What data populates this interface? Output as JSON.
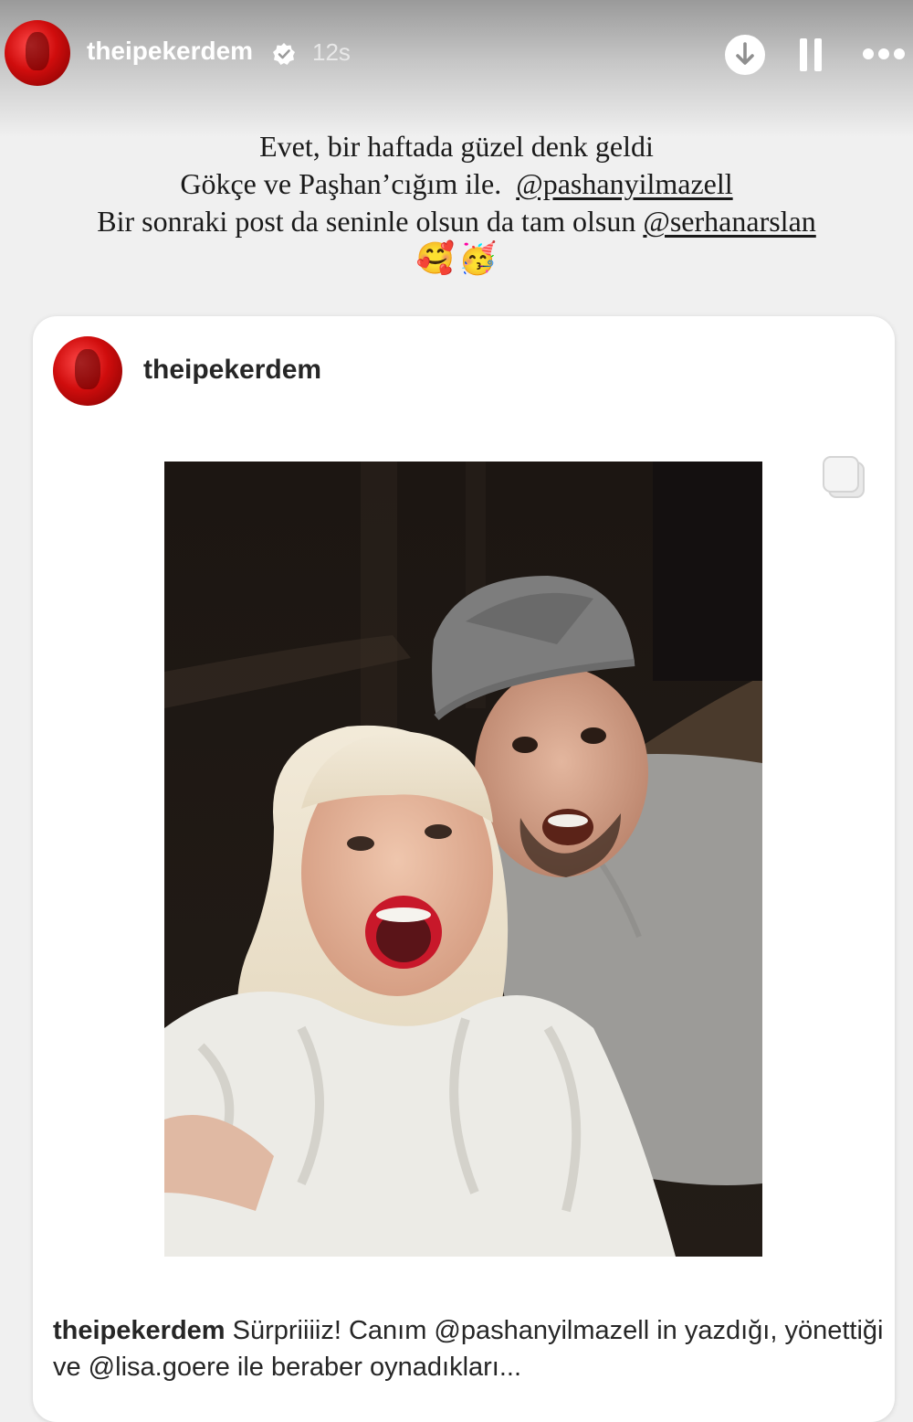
{
  "story": {
    "username": "theipekerdem",
    "timestamp": "12s",
    "verified_icon": "verified-badge-icon",
    "actions": [
      "download-icon",
      "pause-icon",
      "more-icon"
    ]
  },
  "caption": {
    "line1": "Evet, bir haftada güzel denk geldi",
    "line2_text": "Gökçe ve Paşhan’cığım ile.",
    "line2_mention": "@pashanyilmazell",
    "line3_text": "Bir sonraki post da seninle olsun da tam olsun",
    "line3_mention": "@serhanarslan",
    "emoji1": "🥰",
    "emoji2": "🥳"
  },
  "post": {
    "username": "theipekerdem",
    "caption_username": "theipekerdem",
    "caption_text": "Sürpriiiiz! Canım @pashanyilmazell in yazdığı, yönettiği ve @lisa.goere ile beraber oynadıkları..."
  },
  "colors": {
    "avatar_red": "#d00d0d",
    "text_dark": "#262626",
    "card_bg": "#ffffff",
    "story_bg": "#f0f0f0"
  }
}
